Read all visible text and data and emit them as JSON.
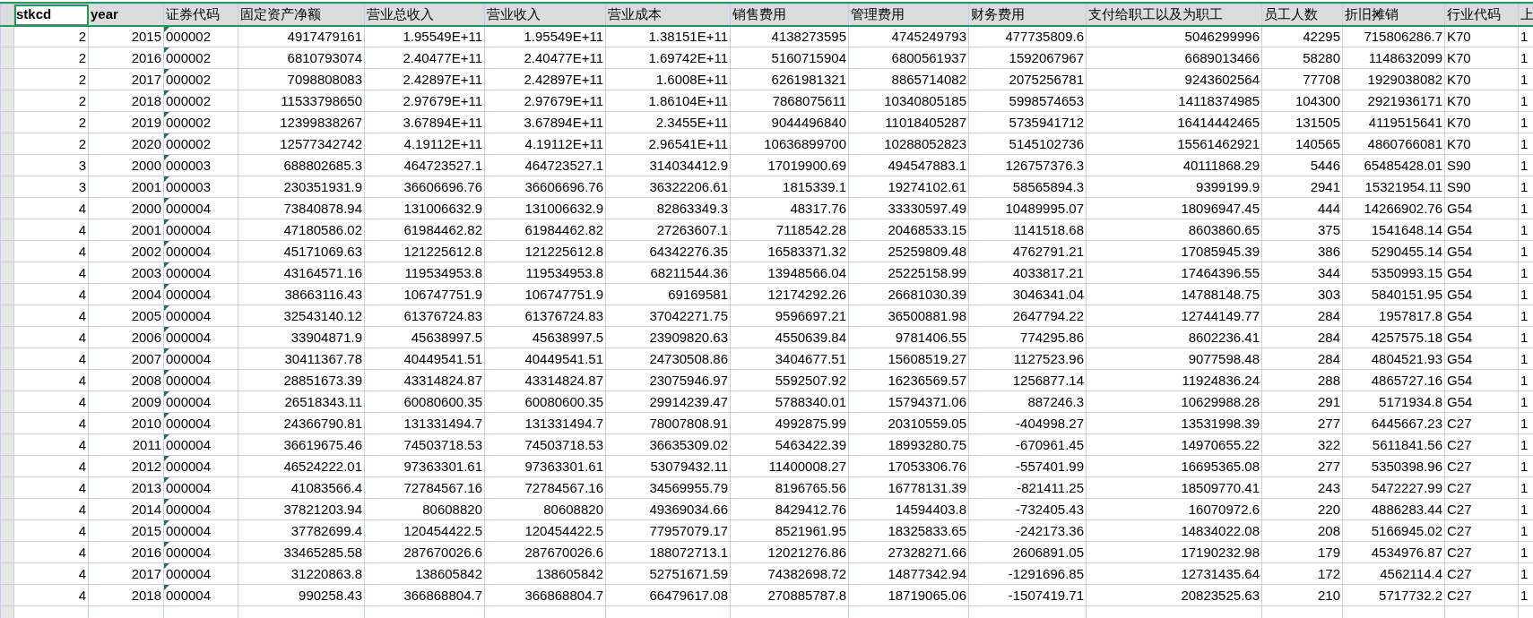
{
  "columns": [
    {
      "label": "stkcd",
      "kind": "number",
      "bold": true,
      "selected": true
    },
    {
      "label": "year",
      "kind": "number",
      "bold": true,
      "selected": false
    },
    {
      "label": "证券代码",
      "kind": "text",
      "bold": false,
      "selected": false
    },
    {
      "label": "固定资产净额",
      "kind": "number",
      "bold": false,
      "selected": false
    },
    {
      "label": "营业总收入",
      "kind": "number",
      "bold": false,
      "selected": false
    },
    {
      "label": "营业收入",
      "kind": "number",
      "bold": false,
      "selected": false
    },
    {
      "label": "营业成本",
      "kind": "number",
      "bold": false,
      "selected": false
    },
    {
      "label": "销售费用",
      "kind": "number",
      "bold": false,
      "selected": false
    },
    {
      "label": "管理费用",
      "kind": "number",
      "bold": false,
      "selected": false
    },
    {
      "label": "财务费用",
      "kind": "number",
      "bold": false,
      "selected": false
    },
    {
      "label": "支付给职工以及为职工",
      "kind": "number",
      "bold": false,
      "selected": false
    },
    {
      "label": "员工人数",
      "kind": "number",
      "bold": false,
      "selected": false
    },
    {
      "label": "折旧摊销",
      "kind": "number",
      "bold": false,
      "selected": false
    },
    {
      "label": "行业代码",
      "kind": "text",
      "bold": false,
      "selected": false
    },
    {
      "label": "上",
      "kind": "text",
      "bold": false,
      "selected": false
    }
  ],
  "rows": [
    {
      "code_warning": true,
      "cells": [
        "2",
        "2015",
        "000002",
        "4917479161",
        "1.95549E+11",
        "1.95549E+11",
        "1.38151E+11",
        "4138273595",
        "4745249793",
        "477735809.6",
        "5046299996",
        "42295",
        "715806286.7",
        "K70",
        "1"
      ]
    },
    {
      "code_warning": true,
      "cells": [
        "2",
        "2016",
        "000002",
        "6810793074",
        "2.40477E+11",
        "2.40477E+11",
        "1.69742E+11",
        "5160715904",
        "6800561937",
        "1592067967",
        "6689013466",
        "58280",
        "1148632099",
        "K70",
        "1"
      ]
    },
    {
      "code_warning": true,
      "cells": [
        "2",
        "2017",
        "000002",
        "7098808083",
        "2.42897E+11",
        "2.42897E+11",
        "1.6008E+11",
        "6261981321",
        "8865714082",
        "2075256781",
        "9243602564",
        "77708",
        "1929038082",
        "K70",
        "1"
      ]
    },
    {
      "code_warning": true,
      "cells": [
        "2",
        "2018",
        "000002",
        "11533798650",
        "2.97679E+11",
        "2.97679E+11",
        "1.86104E+11",
        "7868075611",
        "10340805185",
        "5998574653",
        "14118374985",
        "104300",
        "2921936171",
        "K70",
        "1"
      ]
    },
    {
      "code_warning": true,
      "cells": [
        "2",
        "2019",
        "000002",
        "12399838267",
        "3.67894E+11",
        "3.67894E+11",
        "2.3455E+11",
        "9044496840",
        "11018405287",
        "5735941712",
        "16414442465",
        "131505",
        "4119515641",
        "K70",
        "1"
      ]
    },
    {
      "code_warning": true,
      "cells": [
        "2",
        "2020",
        "000002",
        "12577342742",
        "4.19112E+11",
        "4.19112E+11",
        "2.96541E+11",
        "10636899700",
        "10288052823",
        "5145102736",
        "15561462921",
        "140565",
        "4860766081",
        "K70",
        "1"
      ]
    },
    {
      "code_warning": true,
      "cells": [
        "3",
        "2000",
        "000003",
        "688802685.3",
        "464723527.1",
        "464723527.1",
        "314034412.9",
        "17019900.69",
        "494547883.1",
        "126757376.3",
        "40111868.29",
        "5446",
        "65485428.01",
        "S90",
        "1"
      ]
    },
    {
      "code_warning": true,
      "cells": [
        "3",
        "2001",
        "000003",
        "230351931.9",
        "36606696.76",
        "36606696.76",
        "36322206.61",
        "1815339.1",
        "19274102.61",
        "58565894.3",
        "9399199.9",
        "2941",
        "15321954.11",
        "S90",
        "1"
      ]
    },
    {
      "code_warning": true,
      "cells": [
        "4",
        "2000",
        "000004",
        "73840878.94",
        "131006632.9",
        "131006632.9",
        "82863349.3",
        "48317.76",
        "33330597.49",
        "10489995.07",
        "18096947.45",
        "444",
        "14266902.76",
        "G54",
        "1"
      ]
    },
    {
      "code_warning": true,
      "cells": [
        "4",
        "2001",
        "000004",
        "47180586.02",
        "61984462.82",
        "61984462.82",
        "27263607.1",
        "7118542.28",
        "20468533.15",
        "1141518.68",
        "8603860.65",
        "375",
        "1541648.14",
        "G54",
        "1"
      ]
    },
    {
      "code_warning": true,
      "cells": [
        "4",
        "2002",
        "000004",
        "45171069.63",
        "121225612.8",
        "121225612.8",
        "64342276.35",
        "16583371.32",
        "25259809.48",
        "4762791.21",
        "17085945.39",
        "386",
        "5290455.14",
        "G54",
        "1"
      ]
    },
    {
      "code_warning": true,
      "cells": [
        "4",
        "2003",
        "000004",
        "43164571.16",
        "119534953.8",
        "119534953.8",
        "68211544.36",
        "13948566.04",
        "25225158.99",
        "4033817.21",
        "17464396.55",
        "344",
        "5350993.15",
        "G54",
        "1"
      ]
    },
    {
      "code_warning": true,
      "cells": [
        "4",
        "2004",
        "000004",
        "38663116.43",
        "106747751.9",
        "106747751.9",
        "69169581",
        "12174292.26",
        "26681030.39",
        "3046341.04",
        "14788148.75",
        "303",
        "5840151.95",
        "G54",
        "1"
      ]
    },
    {
      "code_warning": true,
      "cells": [
        "4",
        "2005",
        "000004",
        "32543140.12",
        "61376724.83",
        "61376724.83",
        "37042271.75",
        "9596697.21",
        "36500881.98",
        "2647794.22",
        "12744149.77",
        "284",
        "1957817.8",
        "G54",
        "1"
      ]
    },
    {
      "code_warning": true,
      "cells": [
        "4",
        "2006",
        "000004",
        "33904871.9",
        "45638997.5",
        "45638997.5",
        "23909820.63",
        "4550639.84",
        "9781406.55",
        "774295.86",
        "8602236.41",
        "284",
        "4257575.18",
        "G54",
        "1"
      ]
    },
    {
      "code_warning": true,
      "cells": [
        "4",
        "2007",
        "000004",
        "30411367.78",
        "40449541.51",
        "40449541.51",
        "24730508.86",
        "3404677.51",
        "15608519.27",
        "1127523.96",
        "9077598.48",
        "284",
        "4804521.93",
        "G54",
        "1"
      ]
    },
    {
      "code_warning": true,
      "cells": [
        "4",
        "2008",
        "000004",
        "28851673.39",
        "43314824.87",
        "43314824.87",
        "23075946.97",
        "5592507.92",
        "16236569.57",
        "1256877.14",
        "11924836.24",
        "288",
        "4865727.16",
        "G54",
        "1"
      ]
    },
    {
      "code_warning": true,
      "cells": [
        "4",
        "2009",
        "000004",
        "26518343.11",
        "60080600.35",
        "60080600.35",
        "29914239.47",
        "5788340.01",
        "15794371.06",
        "887246.3",
        "10629988.28",
        "291",
        "5171934.8",
        "G54",
        "1"
      ]
    },
    {
      "code_warning": true,
      "cells": [
        "4",
        "2010",
        "000004",
        "24366790.81",
        "131331494.7",
        "131331494.7",
        "78007808.91",
        "4992875.99",
        "20310559.05",
        "-404998.27",
        "13531998.39",
        "277",
        "6445667.23",
        "C27",
        "1"
      ]
    },
    {
      "code_warning": true,
      "cells": [
        "4",
        "2011",
        "000004",
        "36619675.46",
        "74503718.53",
        "74503718.53",
        "36635309.02",
        "5463422.39",
        "18993280.75",
        "-670961.45",
        "14970655.22",
        "322",
        "5611841.56",
        "C27",
        "1"
      ]
    },
    {
      "code_warning": true,
      "cells": [
        "4",
        "2012",
        "000004",
        "46524222.01",
        "97363301.61",
        "97363301.61",
        "53079432.11",
        "11400008.27",
        "17053306.76",
        "-557401.99",
        "16695365.08",
        "277",
        "5350398.96",
        "C27",
        "1"
      ]
    },
    {
      "code_warning": true,
      "cells": [
        "4",
        "2013",
        "000004",
        "41083566.4",
        "72784567.16",
        "72784567.16",
        "34569955.79",
        "8196765.56",
        "16778131.39",
        "-821411.25",
        "18509770.41",
        "243",
        "5472227.99",
        "C27",
        "1"
      ]
    },
    {
      "code_warning": true,
      "cells": [
        "4",
        "2014",
        "000004",
        "37821203.94",
        "80608820",
        "80608820",
        "49369034.66",
        "8429412.76",
        "14594403.8",
        "-732405.43",
        "16070972.6",
        "220",
        "4886283.44",
        "C27",
        "1"
      ]
    },
    {
      "code_warning": true,
      "cells": [
        "4",
        "2015",
        "000004",
        "37782699.4",
        "120454422.5",
        "120454422.5",
        "77957079.17",
        "8521961.95",
        "18325833.65",
        "-242173.36",
        "14834022.08",
        "208",
        "5166945.02",
        "C27",
        "1"
      ]
    },
    {
      "code_warning": true,
      "cells": [
        "4",
        "2016",
        "000004",
        "33465285.58",
        "287670026.6",
        "287670026.6",
        "188072713.1",
        "12021276.86",
        "27328271.66",
        "2606891.05",
        "17190232.98",
        "179",
        "4534976.87",
        "C27",
        "1"
      ]
    },
    {
      "code_warning": true,
      "cells": [
        "4",
        "2017",
        "000004",
        "31220863.8",
        "138605842",
        "138605842",
        "52751671.59",
        "74382698.72",
        "14877342.94",
        "-1291696.85",
        "12731435.64",
        "172",
        "4562114.4",
        "C27",
        "1"
      ]
    },
    {
      "code_warning": true,
      "cells": [
        "4",
        "2018",
        "000004",
        "990258.43",
        "366868804.7",
        "366868804.7",
        "66479617.08",
        "270885787.8",
        "18719065.06",
        "-1507419.71",
        "20823525.63",
        "210",
        "5717732.2",
        "C27",
        "1"
      ]
    }
  ]
}
